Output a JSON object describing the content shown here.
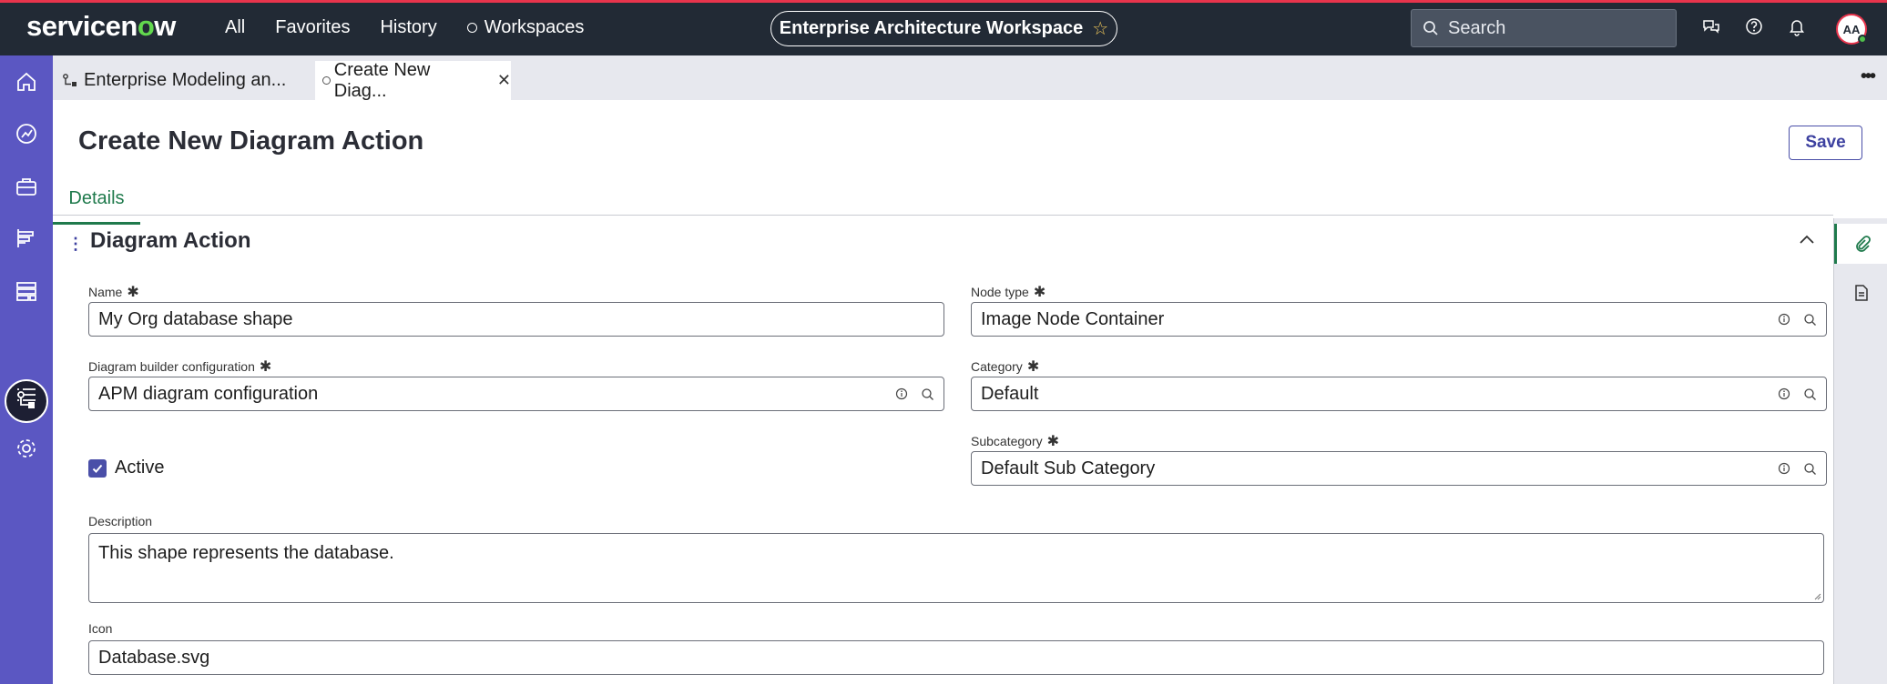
{
  "header": {
    "logo_text": "servicenow",
    "nav": [
      "All",
      "Favorites",
      "History"
    ],
    "workspaces_label": "Workspaces",
    "workspace_pill": "Enterprise Architecture Workspace",
    "search_placeholder": "Search",
    "avatar_initials": "AA",
    "accent_color": "#e8344c"
  },
  "tabs": {
    "tab1_label": "Enterprise Modeling an...",
    "tab2_label": "Create New Diag..."
  },
  "page": {
    "title": "Create New Diagram Action",
    "save_label": "Save",
    "details_tab": "Details",
    "section_title": "Diagram Action"
  },
  "form": {
    "name_label": "Name",
    "name_value": "My Org database shape",
    "node_type_label": "Node type",
    "node_type_value": "Image Node Container",
    "dbc_label": "Diagram builder configuration",
    "dbc_value": "APM diagram configuration",
    "category_label": "Category",
    "category_value": "Default",
    "subcategory_label": "Subcategory",
    "subcategory_value": "Default Sub Category",
    "active_label": "Active",
    "active_checked": true,
    "description_label": "Description",
    "description_value": "This shape represents the database.",
    "icon_label": "Icon",
    "icon_value": "Database.svg",
    "required_marker": "✱"
  },
  "colors": {
    "sidebar": "#5b57c2",
    "topbar": "#222a35",
    "details_tab": "#1f7a4c"
  }
}
